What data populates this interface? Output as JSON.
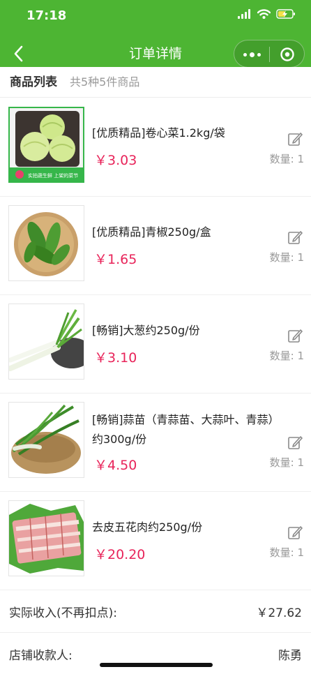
{
  "status_bar": {
    "time": "17:18"
  },
  "nav": {
    "title": "订单详情"
  },
  "list": {
    "title": "商品列表",
    "count": "共5种5件商品"
  },
  "products": [
    {
      "name": "[优质精品]卷心菜1.2kg/袋",
      "price": "￥3.03",
      "qty": "数量: 1",
      "banner_text": "实拍蔬生鲜 上架的菜节"
    },
    {
      "name": "[优质精品]青椒250g/盒",
      "price": "￥1.65",
      "qty": "数量: 1"
    },
    {
      "name": "[畅销]大葱约250g/份",
      "price": "￥3.10",
      "qty": "数量: 1"
    },
    {
      "name": "[畅销]蒜苗（青蒜苗、大蒜叶、青蒜）约300g/份",
      "price": "￥4.50",
      "qty": "数量: 1"
    },
    {
      "name": "去皮五花肉约250g/份",
      "price": "￥20.20",
      "qty": "数量: 1"
    }
  ],
  "summary": {
    "income_label": "实际收入(不再扣点):",
    "income_value": "￥27.62",
    "payee_label": "店铺收款人:",
    "payee_value": "陈勇"
  },
  "colors": {
    "header_green": "#4db533",
    "price_red": "#e8245a",
    "muted": "#999999"
  }
}
